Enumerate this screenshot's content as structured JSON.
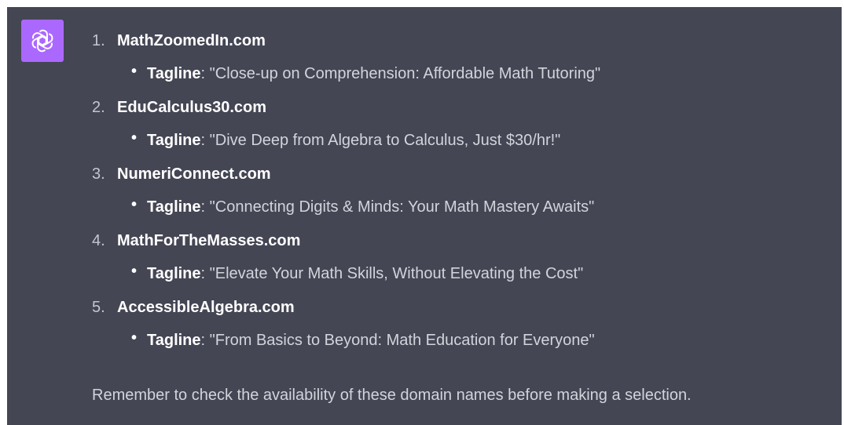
{
  "assistant": {
    "avatar_icon": "openai-logo-icon",
    "avatar_color": "#ab68ff"
  },
  "message": {
    "items": [
      {
        "number": "1.",
        "domain": "MathZoomedIn.com",
        "tag_key": "Tagline",
        "tag_colon": ":",
        "tagline": " \"Close-up on Comprehension: Affordable Math Tutoring\""
      },
      {
        "number": "2.",
        "domain": "EduCalculus30.com",
        "tag_key": "Tagline",
        "tag_colon": ":",
        "tagline": " \"Dive Deep from Algebra to Calculus, Just $30/hr!\""
      },
      {
        "number": "3.",
        "domain": "NumeriConnect.com",
        "tag_key": "Tagline",
        "tag_colon": ":",
        "tagline": " \"Connecting Digits & Minds: Your Math Mastery Awaits\""
      },
      {
        "number": "4.",
        "domain": "MathForTheMasses.com",
        "tag_key": "Tagline",
        "tag_colon": ":",
        "tagline": " \"Elevate Your Math Skills, Without Elevating the Cost\""
      },
      {
        "number": "5.",
        "domain": "AccessibleAlgebra.com",
        "tag_key": "Tagline",
        "tag_colon": ":",
        "tagline": " \"From Basics to Beyond: Math Education for Everyone\""
      }
    ],
    "closing": "Remember to check the availability of these domain names before making a selection."
  },
  "colors": {
    "background": "#444654",
    "text": "#d1d5db",
    "bold_text": "#ffffff"
  }
}
